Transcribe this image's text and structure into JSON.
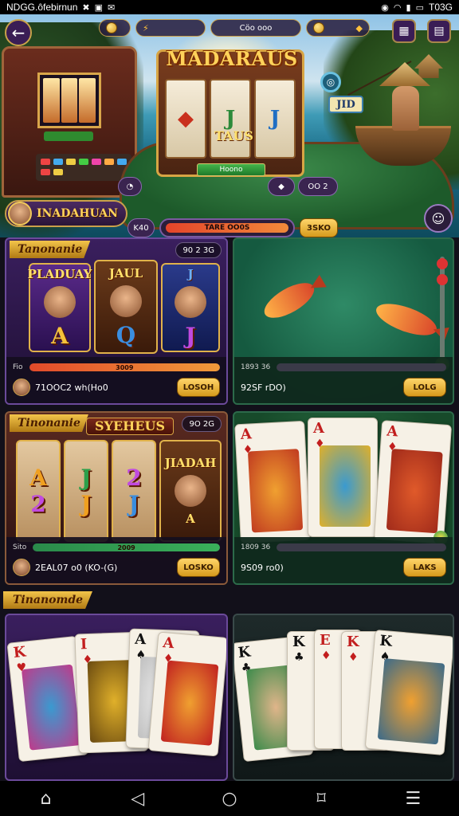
{
  "status_bar": {
    "left_text": "NDGG.ôfebirnun",
    "right_text": "T03G"
  },
  "hero": {
    "top_pill_1": "",
    "top_pill_2": "Cöo ooo",
    "top_pill_3": "",
    "machine_title": "MADARAUS",
    "machine_subtitle": "TAUS",
    "machine_button": "Hoono",
    "side_badge": "JID",
    "table_chip": "OO 2",
    "player_name": "INADAHUAN",
    "small_chip_left": "K40",
    "progress_text": "TARE OO0S",
    "gold_button": "3SKO"
  },
  "games": [
    {
      "label": "Tanonanie",
      "top_count": "90 2 3G",
      "reels": [
        {
          "cap": "PLADUAY",
          "big": "A"
        },
        {
          "cap": "JAUL",
          "big": "Q"
        },
        {
          "cap": "J",
          "big": "J"
        }
      ],
      "progress_label": "Fio",
      "progress_value": "3009",
      "info_text": "71OOC2 wh(Ho0",
      "play_label": "LOSOH"
    },
    {
      "label": "",
      "top_count": "",
      "progress_label": "1893 36",
      "progress_value": "",
      "info_text": "92SF rDO)",
      "play_label": "LOLG"
    },
    {
      "label": "Tinonanie",
      "banner": "SYEHEUS",
      "top_count": "9O 2G",
      "reels": [
        {
          "cap": "A",
          "big": "2"
        },
        {
          "cap": "J",
          "big": "J"
        },
        {
          "cap": "2",
          "big": "J"
        },
        {
          "cap": "JIADAH",
          "big": "A"
        }
      ],
      "progress_label": "Sito",
      "progress_value": "2009",
      "info_text": "2EAL07 o0 (KO-(G)",
      "play_label": "LOSKO"
    },
    {
      "label": "",
      "top_count": "",
      "progress_label": "1809 36",
      "progress_value": "",
      "info_text": "9S09 ro0)",
      "play_label": "LAKS"
    }
  ],
  "section_label": "Tinanomde",
  "bottom_cards_left": [
    "K",
    "I",
    "A",
    "A"
  ],
  "bottom_cards_right": [
    "K",
    "K",
    "E",
    "K",
    "K"
  ],
  "nav": {
    "home_icon": "home-icon",
    "back_icon": "back-triangle-icon",
    "circle_icon": "home-circle-icon",
    "recent_icon": "bookmark-icon",
    "menu_icon": "menu-icon"
  }
}
